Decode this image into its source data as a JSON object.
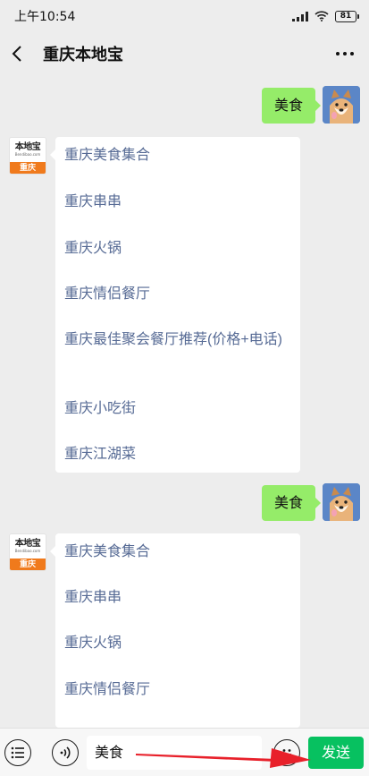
{
  "status_bar": {
    "time": "上午10:54",
    "battery": "81"
  },
  "header": {
    "title": "重庆本地宝"
  },
  "bot": {
    "logo_name": "本地宝",
    "logo_url": "Bendibao.com",
    "logo_city": "重庆"
  },
  "messages": [
    {
      "user_text": "美食",
      "links": [
        "重庆美食集合",
        "重庆串串",
        "重庆火锅",
        "重庆情侣餐厅",
        "重庆最佳聚会餐厅推荐(价格+电话)",
        "重庆小吃街",
        "重庆江湖菜"
      ]
    },
    {
      "user_text": "美食",
      "links": [
        "重庆美食集合",
        "重庆串串",
        "重庆火锅",
        "重庆情侣餐厅"
      ]
    }
  ],
  "input_bar": {
    "value": "美食",
    "send_label": "发送"
  },
  "colors": {
    "send": "#07c160",
    "bubble": "#95ec69",
    "link": "#576b95",
    "arrow": "#e8202a"
  }
}
